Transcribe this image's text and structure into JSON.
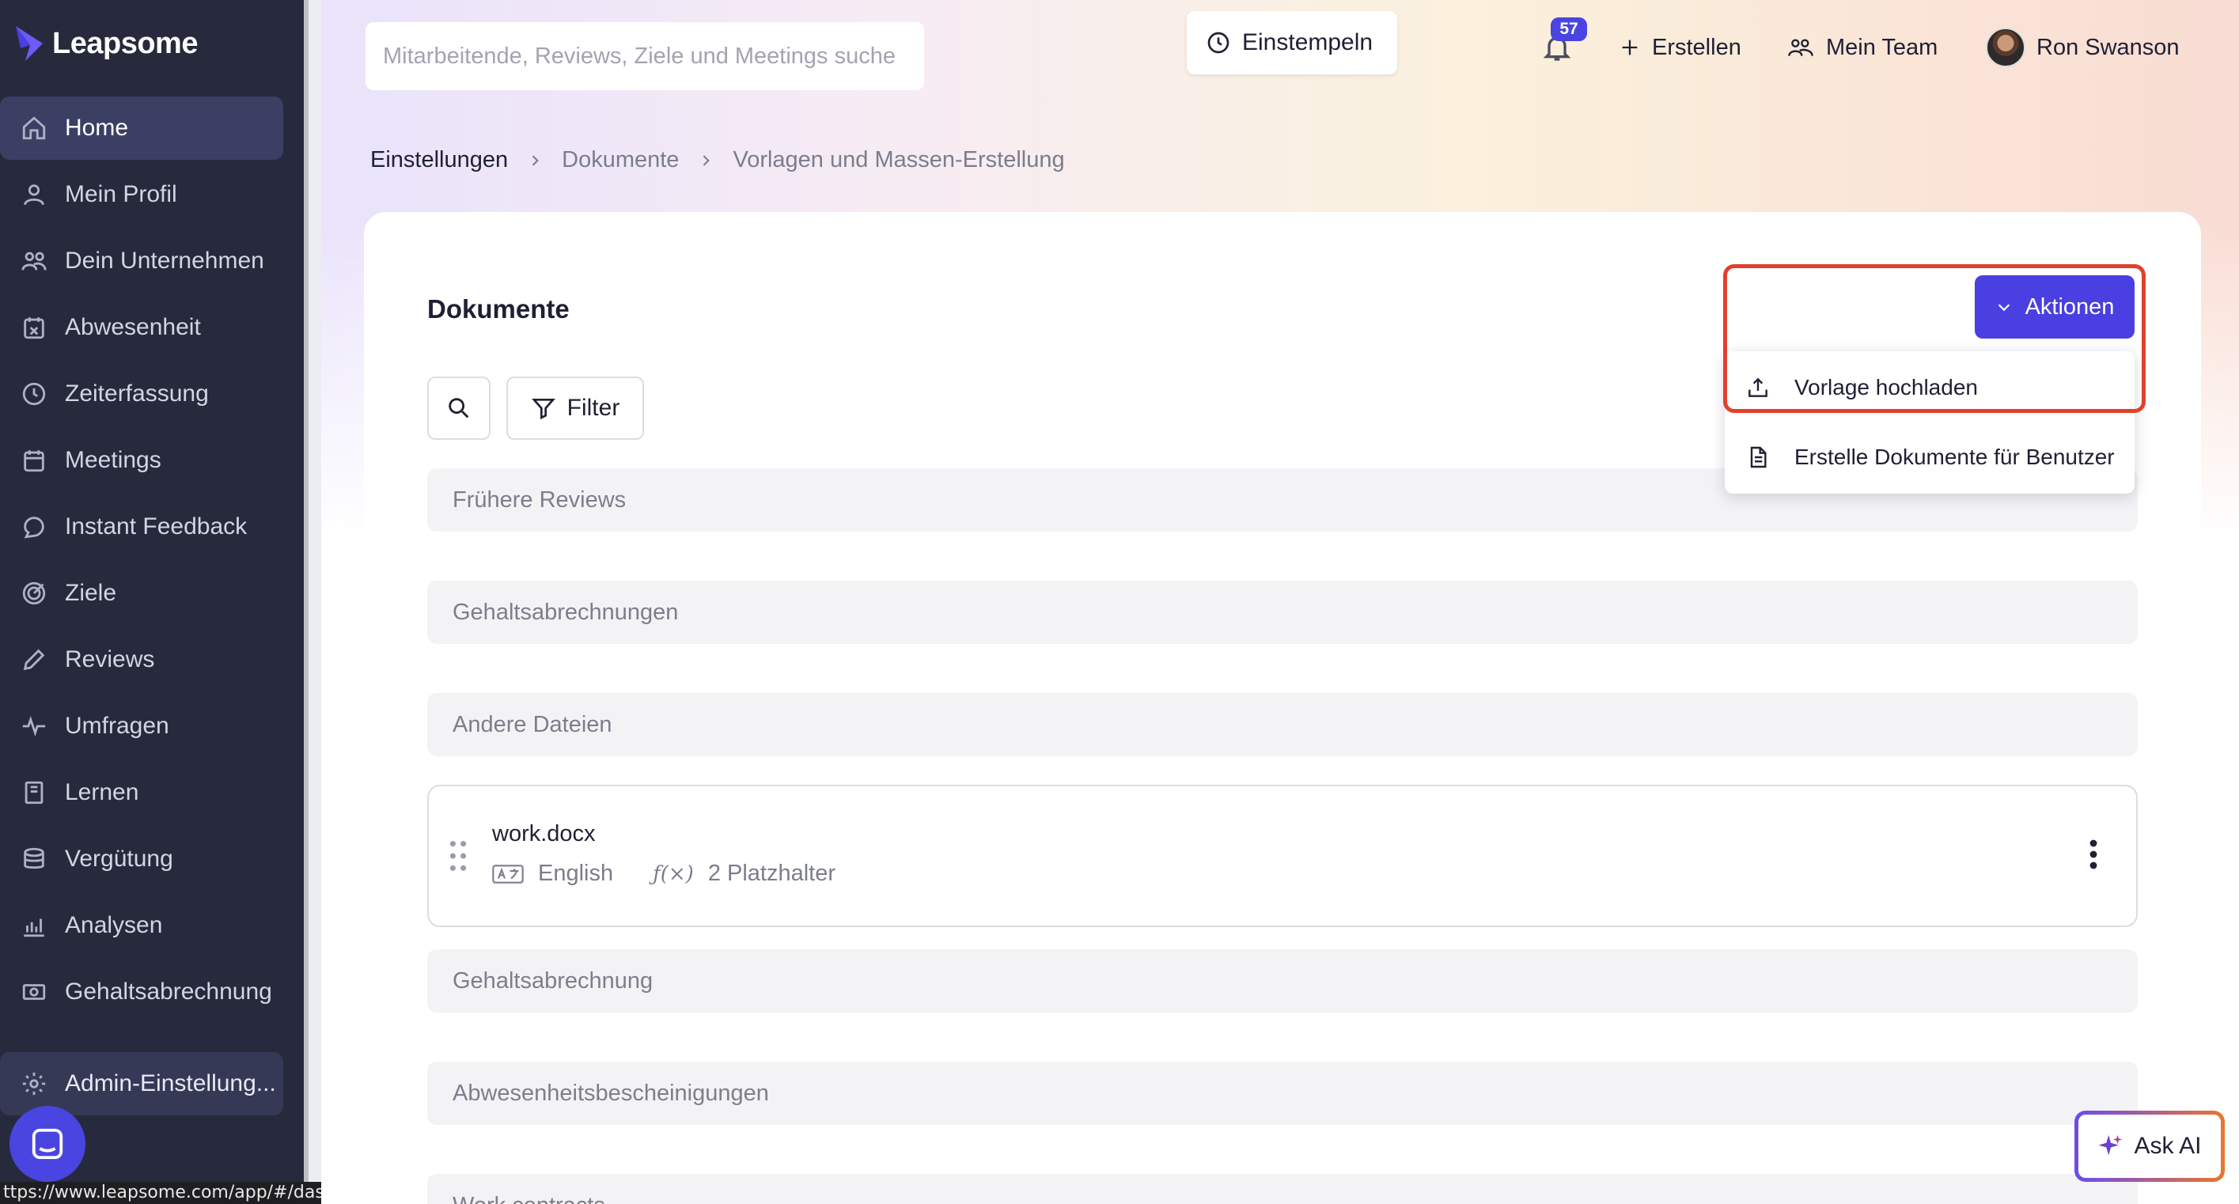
{
  "app": {
    "name": "Leapsome"
  },
  "sidebar": {
    "items": [
      {
        "label": "Home",
        "icon": "home-icon",
        "active": true
      },
      {
        "label": "Mein Profil",
        "icon": "user-icon"
      },
      {
        "label": "Dein Unternehmen",
        "icon": "users-icon"
      },
      {
        "label": "Abwesenheit",
        "icon": "calendar-x-icon"
      },
      {
        "label": "Zeiterfassung",
        "icon": "clock-icon"
      },
      {
        "label": "Meetings",
        "icon": "calendar-icon"
      },
      {
        "label": "Instant Feedback",
        "icon": "chat-icon"
      },
      {
        "label": "Ziele",
        "icon": "target-icon"
      },
      {
        "label": "Reviews",
        "icon": "pencil-icon"
      },
      {
        "label": "Umfragen",
        "icon": "pulse-icon"
      },
      {
        "label": "Lernen",
        "icon": "book-icon"
      },
      {
        "label": "Vergütung",
        "icon": "coins-icon"
      },
      {
        "label": "Analysen",
        "icon": "chart-icon"
      },
      {
        "label": "Gehaltsabrechnung",
        "icon": "money-icon"
      }
    ],
    "admin": {
      "label": "Admin-Einstellung...",
      "icon": "gear-icon"
    }
  },
  "statusbar": {
    "url": "ttps://www.leapsome.com/app/#/dashboard"
  },
  "topbar": {
    "search_placeholder": "Mitarbeitende, Reviews, Ziele und Meetings suche",
    "clockin_label": "Einstempeln",
    "notifications_count": "57",
    "create_label": "Erstellen",
    "team_label": "Mein Team",
    "user_name": "Ron Swanson"
  },
  "breadcrumb": [
    "Einstellungen",
    "Dokumente",
    "Vorlagen und Massen-Erstellung"
  ],
  "card": {
    "title": "Dokumente",
    "filter_label": "Filter",
    "sections": [
      "Frühere Reviews",
      "Gehaltsabrechnungen",
      "Andere Dateien",
      "Gehaltsabrechnung",
      "Abwesenheitsbescheinigungen",
      "Work contracts"
    ],
    "document": {
      "name": "work.docx",
      "language": "English",
      "placeholders": "2 Platzhalter",
      "formula_symbol": "ƒ(×)"
    }
  },
  "actions": {
    "button_label": "Aktionen",
    "menu": [
      {
        "label": "Vorlage hochladen",
        "icon": "upload-icon"
      },
      {
        "label": "Erstelle Dokumente für Benutzer",
        "icon": "document-icon"
      }
    ]
  },
  "ask_ai": {
    "label": "Ask AI"
  },
  "colors": {
    "accent": "#4a3fe0",
    "sidebar_bg": "#272a3d",
    "highlight": "#e2402c"
  }
}
